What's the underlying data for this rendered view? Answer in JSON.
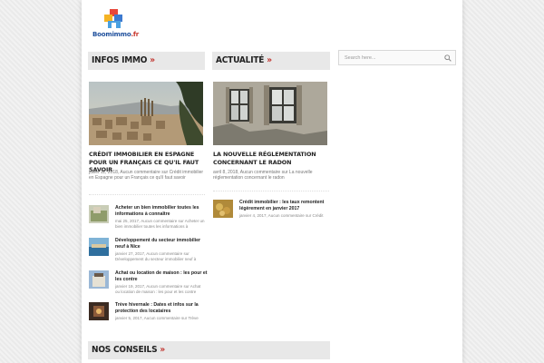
{
  "logo": {
    "name": "Boomimmo",
    "suffix": ".fr"
  },
  "search": {
    "placeholder": "Search here..."
  },
  "sections": {
    "infos": {
      "title": "Infos immo",
      "arrows": "»"
    },
    "actualite": {
      "title": "Actualité",
      "arrows": "»"
    },
    "conseils": {
      "title": "Nos conseils",
      "arrows": "»"
    }
  },
  "infos_feature": {
    "title": "Crédit immobilier en Espagne pour un Français ce qu'il faut savoir",
    "meta": "juillet 11, 2018, Aucun commentaire sur Crédit immobilier en Espagne pour un Français ce qu'il faut savoir"
  },
  "actualite_feature": {
    "title": "La nouvelle réglementation concernant le radon",
    "meta": "avril 8, 2018, Aucun commentaire sur La nouvelle réglementation concernant le radon"
  },
  "infos_list": [
    {
      "title": "Acheter un bien immobilier toutes les informations à connaître",
      "meta": "mai 25, 2017, Aucun commentaire sur Acheter un bien immobilier toutes les informations à"
    },
    {
      "title": "Développement du secteur immobilier neuf à Nice",
      "meta": "janvier 27, 2017, Aucun commentaire sur Développement du secteur immobilier neuf à"
    },
    {
      "title": "Achat ou location de maison : les pour et les contre",
      "meta": "janvier 19, 2017, Aucun commentaire sur Achat ou location de maison : les pour et les contre"
    },
    {
      "title": "Trève hivernale : Dates et infos sur la protection des locataires",
      "meta": "janvier 5, 2017, Aucun commentaire sur Trève"
    }
  ],
  "actualite_list": [
    {
      "title": "Crédit immobilier : les taux remontent légèrement en janvier 2017",
      "meta": "janvier 4, 2017, Aucun commentaire sur Crédit"
    }
  ]
}
